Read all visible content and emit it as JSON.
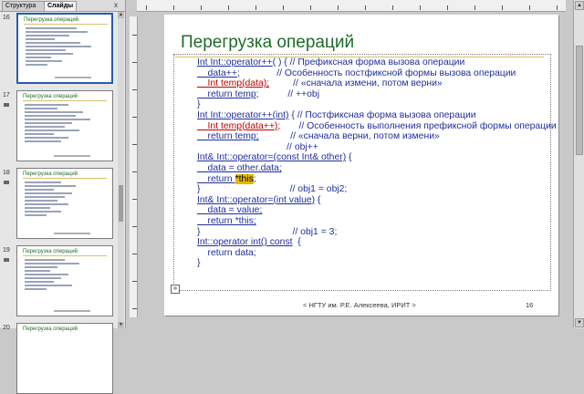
{
  "left_pane": {
    "tab_structure": "Структура",
    "tab_slides": "Слайды",
    "close_glyph": "x",
    "thumbnails": [
      {
        "number": "16",
        "title": "Перегрузка операций"
      },
      {
        "number": "17",
        "title": "Перегрузка операций"
      },
      {
        "number": "18",
        "title": "Перегрузка операций"
      },
      {
        "number": "19",
        "title": "Перегрузка операций"
      },
      {
        "number": "20",
        "title": "Перегрузка операций"
      }
    ]
  },
  "slide": {
    "title": "Перегрузка операций",
    "footer": "< НГТУ им. Р.Е. Алексеева, ИРИТ >",
    "number": "16",
    "code": {
      "l01a": "Int Int::operator++",
      "l01b": "( ) { // Префиксная форма вызова операции",
      "l02a": "    data++;",
      "l02b": "              // Особенность постфиксной формы вызова операции",
      "l03a": "    Int temp(data);",
      "l03b": "         // «сначала измени, потом верни»",
      "l04a": "    return temp;",
      "l04b": "           // ++obj",
      "l05": "}",
      "l06a": "Int Int::operator++(int)",
      "l06b": " { // Постфиксная форма вызова операции",
      "l07a": "    Int temp(data++);",
      "l07b": "       // Особенность выполнения префиксной формы операции",
      "l08a": "    return temp;",
      "l08b": "            // «сначала верни, потом измени»",
      "l09": "                                  // obj++",
      "l10a": "Int& Int::operator=(const Int& other)",
      "l10b": " {",
      "l11a": "    data = other.data;",
      "l12a": "    return ",
      "l12b": "*this",
      "l12c": ";",
      "l13a": "}",
      "l13b": "                                  // obj1 = obj2;",
      "l14a": "Int& Int::operator=(int value)",
      "l14b": " {",
      "l15a": "    data = value;",
      "l16a": "    return *this;",
      "l17a": "}",
      "l17b": "                                   // obj1 = 3;",
      "l18a": "Int::operator int() const",
      "l18b": "  {",
      "l19a": "    return data;",
      "l20": "}"
    }
  },
  "colors": {
    "title_green": "#1f6b2a",
    "code_blue": "#1f2f9a",
    "code_red": "#c00000",
    "highlight": "#e7b800"
  }
}
